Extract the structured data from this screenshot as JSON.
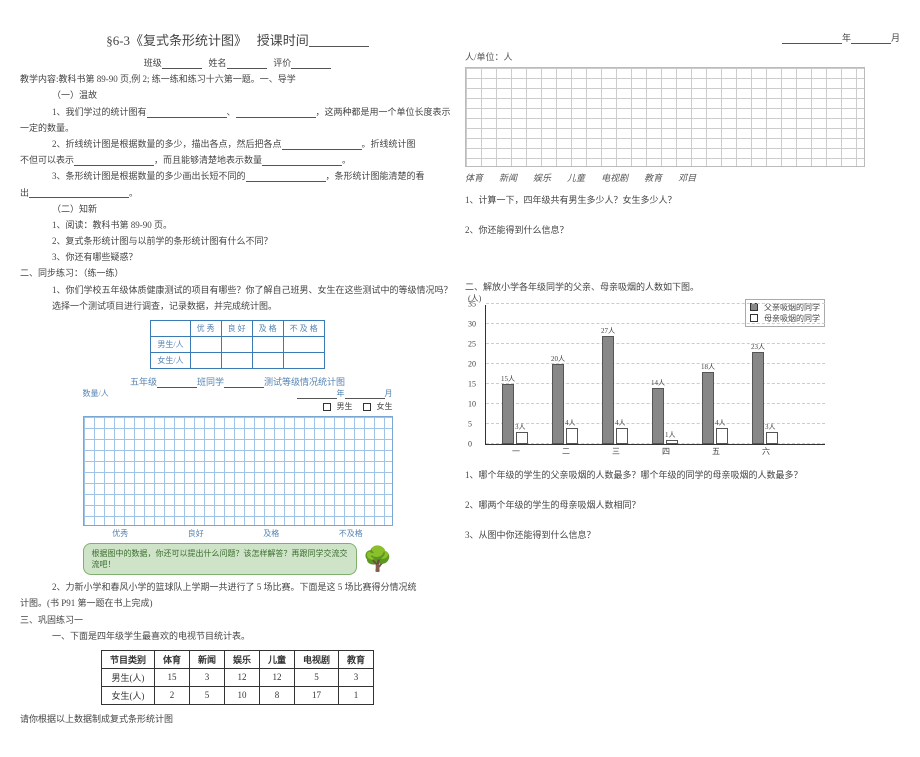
{
  "header": {
    "title": "§6-3《复式条形统计图》",
    "time_label": "授课时间",
    "class_label": "班级",
    "name_label": "姓名",
    "eval_label": "评价"
  },
  "left": {
    "content_line": "教学内容:教科书第 89-90 页,例 2; 练一练和练习十六第一题。一、导学",
    "s1_title": "（一）温故",
    "p1a": "1、我们学过的统计图有",
    "p1b": "、",
    "p1c": "，这两种都是用一个单位长度表示",
    "p1d": "一定的数量。",
    "p2a": "2、折线统计图是根据数量的多少，描出各点，然后把各点",
    "p2b": "。折线统计图",
    "p2c": "不但可以表示",
    "p2d": "，而且能够清楚地表示数量",
    "p2e": "。",
    "p3a": "3、条形统计图是根据数量的多少画出长短不同的",
    "p3b": "，条形统计图能清楚的看",
    "p3c": "出",
    "p3d": "。",
    "s2_title": "（二）知新",
    "s2_1": "1、阅读：教科书第 89-90 页。",
    "s2_2": "2、复式条形统计图与以前学的条形统计图有什么不同？",
    "s2_3": "3、你还有哪些疑惑？",
    "sync_title": "二、同步练习：（练一练）",
    "sync_1": "1、你们学校五年级体质健康测试的项目有哪些？你了解自己班男、女生在这些测试中的等级情况吗？选择一个测试项目进行调查，记录数据，并完成统计图。",
    "tbl1": {
      "r1": "男生/人",
      "r2": "女生/人",
      "c1": "优 秀",
      "c2": "良 好",
      "c3": "及 格",
      "c4": "不 及 格"
    },
    "chart_caption_a": "五年级",
    "chart_caption_b": "班同学",
    "chart_caption_c": "测试等级情况统计图",
    "y_label": "数量/人",
    "date_labels": {
      "y": "年",
      "m": "月"
    },
    "leg_boy": "男生",
    "leg_girl": "女生",
    "x": {
      "a": "优秀",
      "b": "良好",
      "c": "及格",
      "d": "不及格"
    },
    "bubble": "根据图中的数据，你还可以提出什么问题？该怎样解答？再跟同学交流交流吧！",
    "sync_2a": "2、力新小学和春风小学的篮球队上学期一共进行了 5 场比赛。下面是这 5 场比赛得分情况统",
    "sync_2b": "计图。(书 P91 第一题在书上完成)",
    "gq_title": "三、巩固练习一",
    "gq_1": "一、下面是四年级学生最喜欢的电视节目统计表。",
    "tbl2": {
      "h0": "节目类别",
      "h1": "体育",
      "h2": "新闻",
      "h3": "娱乐",
      "h4": "儿童",
      "h5": "电视剧",
      "h6": "教育",
      "r1l": "男生(人)",
      "r1": [
        "15",
        "3",
        "12",
        "12",
        "5",
        "3"
      ],
      "r2l": "女生(人)",
      "r2": [
        "2",
        "5",
        "10",
        "8",
        "17",
        "1"
      ]
    },
    "gq_2": "请你根据以上数据制成复式条形统计图"
  },
  "right": {
    "date_y": "年",
    "date_m": "月",
    "unit": "人/单位：人",
    "cats": {
      "a": "体育",
      "b": "新闻",
      "c": "娱乐",
      "d": "儿童",
      "e": "电视剧",
      "f": "教育",
      "g": "邓目"
    },
    "q1": "1、计算一下，四年级共有男生多少人？女生多少人？",
    "q2": "2、你还能得到什么信息？",
    "sec2": "二、解放小学各年级同学的父亲、母亲吸烟的人数如下图。",
    "leg_f": "父亲吸烟的同学",
    "leg_m": "母亲吸烟的同学",
    "ylabel": "(人)",
    "q3": "1、哪个年级的学生的父亲吸烟的人数最多？哪个年级的同学的母亲吸烟的人数最多？",
    "q4": "2、哪两个年级的学生的母亲吸烟人数相同？",
    "q5": "3、从图中你还能得到什么信息？"
  },
  "chart_data": [
    {
      "type": "table",
      "title": "四年级学生最喜欢的电视节目",
      "categories": [
        "体育",
        "新闻",
        "娱乐",
        "儿童",
        "电视剧",
        "教育"
      ],
      "series": [
        {
          "name": "男生(人)",
          "values": [
            15,
            3,
            12,
            12,
            5,
            3
          ]
        },
        {
          "name": "女生(人)",
          "values": [
            2,
            5,
            10,
            8,
            17,
            1
          ]
        }
      ]
    },
    {
      "type": "bar",
      "title": "解放小学各年级同学父母吸烟人数",
      "categories": [
        "一",
        "二",
        "三",
        "四",
        "五",
        "六"
      ],
      "series": [
        {
          "name": "父亲吸烟的同学",
          "values": [
            15,
            20,
            27,
            14,
            18,
            23
          ]
        },
        {
          "name": "母亲吸烟的同学",
          "values": [
            3,
            4,
            4,
            1,
            4,
            3
          ]
        }
      ],
      "ylabel": "(人)",
      "ylim": [
        0,
        35
      ],
      "yticks": [
        0,
        5,
        10,
        15,
        20,
        25,
        30,
        35
      ]
    }
  ]
}
